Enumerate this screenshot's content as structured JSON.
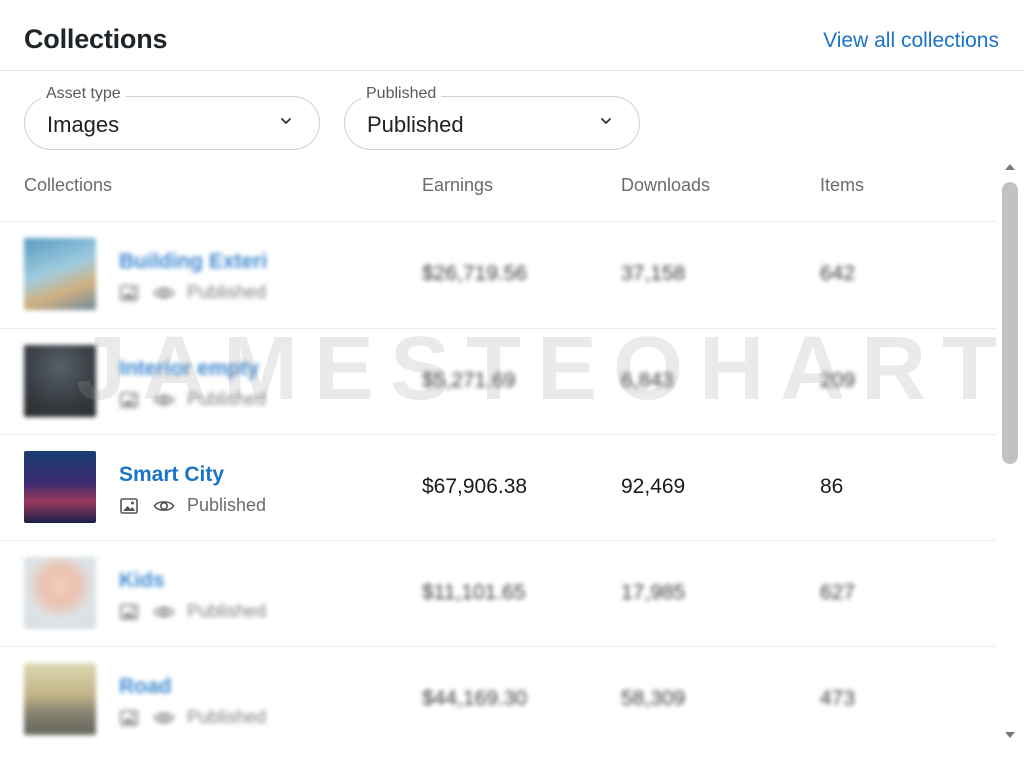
{
  "header": {
    "title": "Collections",
    "view_all": "View all collections"
  },
  "filters": {
    "asset_type": {
      "label": "Asset type",
      "value": "Images"
    },
    "status": {
      "label": "Published",
      "value": "Published"
    }
  },
  "table": {
    "columns": [
      "Collections",
      "Earnings",
      "Downloads",
      "Items"
    ],
    "rows": [
      {
        "name": "Building Exteri",
        "status": "Published",
        "earnings": "$26,719.56",
        "downloads": "37,158",
        "items": "642"
      },
      {
        "name": "Interior empty",
        "status": "Published",
        "earnings": "$5,271.69",
        "downloads": "6,843",
        "items": "209"
      },
      {
        "name": "Smart City",
        "status": "Published",
        "earnings": "$67,906.38",
        "downloads": "92,469",
        "items": "86"
      },
      {
        "name": "Kids",
        "status": "Published",
        "earnings": "$11,101.65",
        "downloads": "17,985",
        "items": "627"
      },
      {
        "name": "Road",
        "status": "Published",
        "earnings": "$44,169.30",
        "downloads": "58,309",
        "items": "473"
      }
    ]
  },
  "watermark": "JAMESTEOHART",
  "colors": {
    "link": "#1b74c8",
    "divider": "#e6e6e6",
    "scrollbar": "#c2c2c2"
  }
}
